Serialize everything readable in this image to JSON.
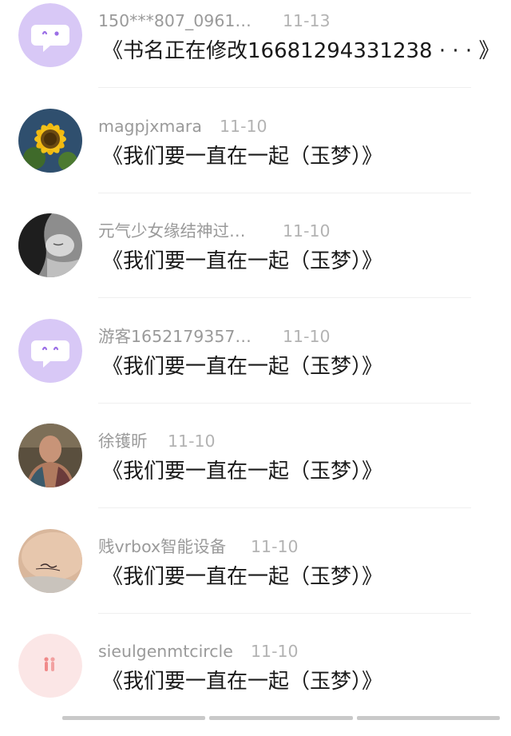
{
  "comments": [
    {
      "avatar": "default-chat-avatar",
      "user": "150***807_0961…",
      "time": "11-13",
      "title": "《书名正在修改16681294331238 · · · 》"
    },
    {
      "avatar": "sunflower-avatar",
      "user": "magpjxmara",
      "time": "11-10",
      "title": "《我们要一直在一起（玉梦）》"
    },
    {
      "avatar": "sleeping-person-avatar",
      "user": "元气少女缘结神过…",
      "time": "11-10",
      "title": "《我们要一直在一起（玉梦）》"
    },
    {
      "avatar": "default-chat-avatar",
      "user": "游客1652179357…",
      "time": "11-10",
      "title": "《我们要一直在一起（玉梦）》"
    },
    {
      "avatar": "man-photo-avatar",
      "user": "徐镬昕",
      "time": "11-10",
      "title": "《我们要一直在一起（玉梦）》"
    },
    {
      "avatar": "tattoo-skin-avatar",
      "user": "贱vrbox智能设备",
      "time": "11-10",
      "title": "《我们要一直在一起（玉梦）》"
    },
    {
      "avatar": "pink-figures-avatar",
      "user": "sieulgenmtcircle",
      "time": "11-10",
      "title": "《我们要一直在一起（玉梦）》"
    }
  ],
  "colors": {
    "default_avatar_bg": "#d8c8f6",
    "default_avatar_accent": "#9b6fe6",
    "username": "#9a9a9a",
    "time": "#b3b3b3",
    "title": "#1a1a1a"
  }
}
